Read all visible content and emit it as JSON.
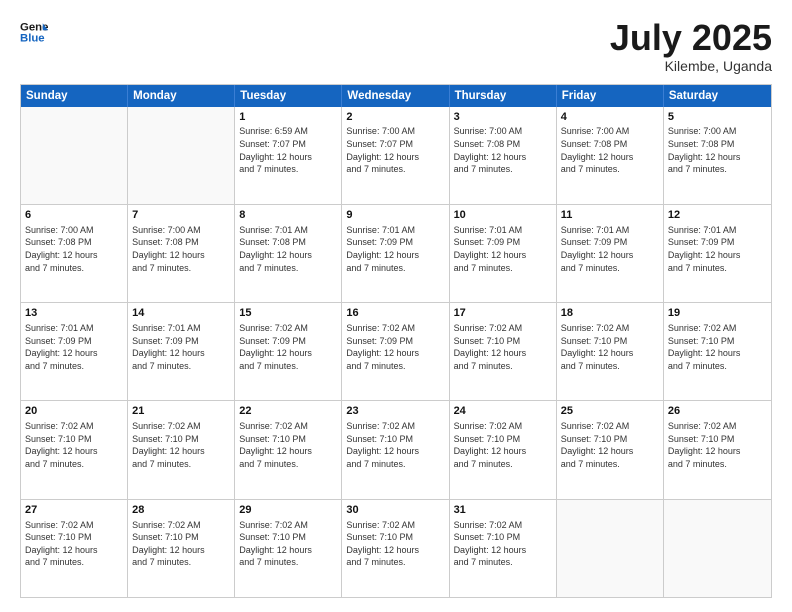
{
  "logo": {
    "line1": "General",
    "line2": "Blue"
  },
  "title": "July 2025",
  "location": "Kilembe, Uganda",
  "days_header": [
    "Sunday",
    "Monday",
    "Tuesday",
    "Wednesday",
    "Thursday",
    "Friday",
    "Saturday"
  ],
  "weeks": [
    [
      {
        "day": "",
        "info": ""
      },
      {
        "day": "",
        "info": ""
      },
      {
        "day": "1",
        "info": "Sunrise: 6:59 AM\nSunset: 7:07 PM\nDaylight: 12 hours\nand 7 minutes."
      },
      {
        "day": "2",
        "info": "Sunrise: 7:00 AM\nSunset: 7:07 PM\nDaylight: 12 hours\nand 7 minutes."
      },
      {
        "day": "3",
        "info": "Sunrise: 7:00 AM\nSunset: 7:08 PM\nDaylight: 12 hours\nand 7 minutes."
      },
      {
        "day": "4",
        "info": "Sunrise: 7:00 AM\nSunset: 7:08 PM\nDaylight: 12 hours\nand 7 minutes."
      },
      {
        "day": "5",
        "info": "Sunrise: 7:00 AM\nSunset: 7:08 PM\nDaylight: 12 hours\nand 7 minutes."
      }
    ],
    [
      {
        "day": "6",
        "info": "Sunrise: 7:00 AM\nSunset: 7:08 PM\nDaylight: 12 hours\nand 7 minutes."
      },
      {
        "day": "7",
        "info": "Sunrise: 7:00 AM\nSunset: 7:08 PM\nDaylight: 12 hours\nand 7 minutes."
      },
      {
        "day": "8",
        "info": "Sunrise: 7:01 AM\nSunset: 7:08 PM\nDaylight: 12 hours\nand 7 minutes."
      },
      {
        "day": "9",
        "info": "Sunrise: 7:01 AM\nSunset: 7:09 PM\nDaylight: 12 hours\nand 7 minutes."
      },
      {
        "day": "10",
        "info": "Sunrise: 7:01 AM\nSunset: 7:09 PM\nDaylight: 12 hours\nand 7 minutes."
      },
      {
        "day": "11",
        "info": "Sunrise: 7:01 AM\nSunset: 7:09 PM\nDaylight: 12 hours\nand 7 minutes."
      },
      {
        "day": "12",
        "info": "Sunrise: 7:01 AM\nSunset: 7:09 PM\nDaylight: 12 hours\nand 7 minutes."
      }
    ],
    [
      {
        "day": "13",
        "info": "Sunrise: 7:01 AM\nSunset: 7:09 PM\nDaylight: 12 hours\nand 7 minutes."
      },
      {
        "day": "14",
        "info": "Sunrise: 7:01 AM\nSunset: 7:09 PM\nDaylight: 12 hours\nand 7 minutes."
      },
      {
        "day": "15",
        "info": "Sunrise: 7:02 AM\nSunset: 7:09 PM\nDaylight: 12 hours\nand 7 minutes."
      },
      {
        "day": "16",
        "info": "Sunrise: 7:02 AM\nSunset: 7:09 PM\nDaylight: 12 hours\nand 7 minutes."
      },
      {
        "day": "17",
        "info": "Sunrise: 7:02 AM\nSunset: 7:10 PM\nDaylight: 12 hours\nand 7 minutes."
      },
      {
        "day": "18",
        "info": "Sunrise: 7:02 AM\nSunset: 7:10 PM\nDaylight: 12 hours\nand 7 minutes."
      },
      {
        "day": "19",
        "info": "Sunrise: 7:02 AM\nSunset: 7:10 PM\nDaylight: 12 hours\nand 7 minutes."
      }
    ],
    [
      {
        "day": "20",
        "info": "Sunrise: 7:02 AM\nSunset: 7:10 PM\nDaylight: 12 hours\nand 7 minutes."
      },
      {
        "day": "21",
        "info": "Sunrise: 7:02 AM\nSunset: 7:10 PM\nDaylight: 12 hours\nand 7 minutes."
      },
      {
        "day": "22",
        "info": "Sunrise: 7:02 AM\nSunset: 7:10 PM\nDaylight: 12 hours\nand 7 minutes."
      },
      {
        "day": "23",
        "info": "Sunrise: 7:02 AM\nSunset: 7:10 PM\nDaylight: 12 hours\nand 7 minutes."
      },
      {
        "day": "24",
        "info": "Sunrise: 7:02 AM\nSunset: 7:10 PM\nDaylight: 12 hours\nand 7 minutes."
      },
      {
        "day": "25",
        "info": "Sunrise: 7:02 AM\nSunset: 7:10 PM\nDaylight: 12 hours\nand 7 minutes."
      },
      {
        "day": "26",
        "info": "Sunrise: 7:02 AM\nSunset: 7:10 PM\nDaylight: 12 hours\nand 7 minutes."
      }
    ],
    [
      {
        "day": "27",
        "info": "Sunrise: 7:02 AM\nSunset: 7:10 PM\nDaylight: 12 hours\nand 7 minutes."
      },
      {
        "day": "28",
        "info": "Sunrise: 7:02 AM\nSunset: 7:10 PM\nDaylight: 12 hours\nand 7 minutes."
      },
      {
        "day": "29",
        "info": "Sunrise: 7:02 AM\nSunset: 7:10 PM\nDaylight: 12 hours\nand 7 minutes."
      },
      {
        "day": "30",
        "info": "Sunrise: 7:02 AM\nSunset: 7:10 PM\nDaylight: 12 hours\nand 7 minutes."
      },
      {
        "day": "31",
        "info": "Sunrise: 7:02 AM\nSunset: 7:10 PM\nDaylight: 12 hours\nand 7 minutes."
      },
      {
        "day": "",
        "info": ""
      },
      {
        "day": "",
        "info": ""
      }
    ]
  ]
}
